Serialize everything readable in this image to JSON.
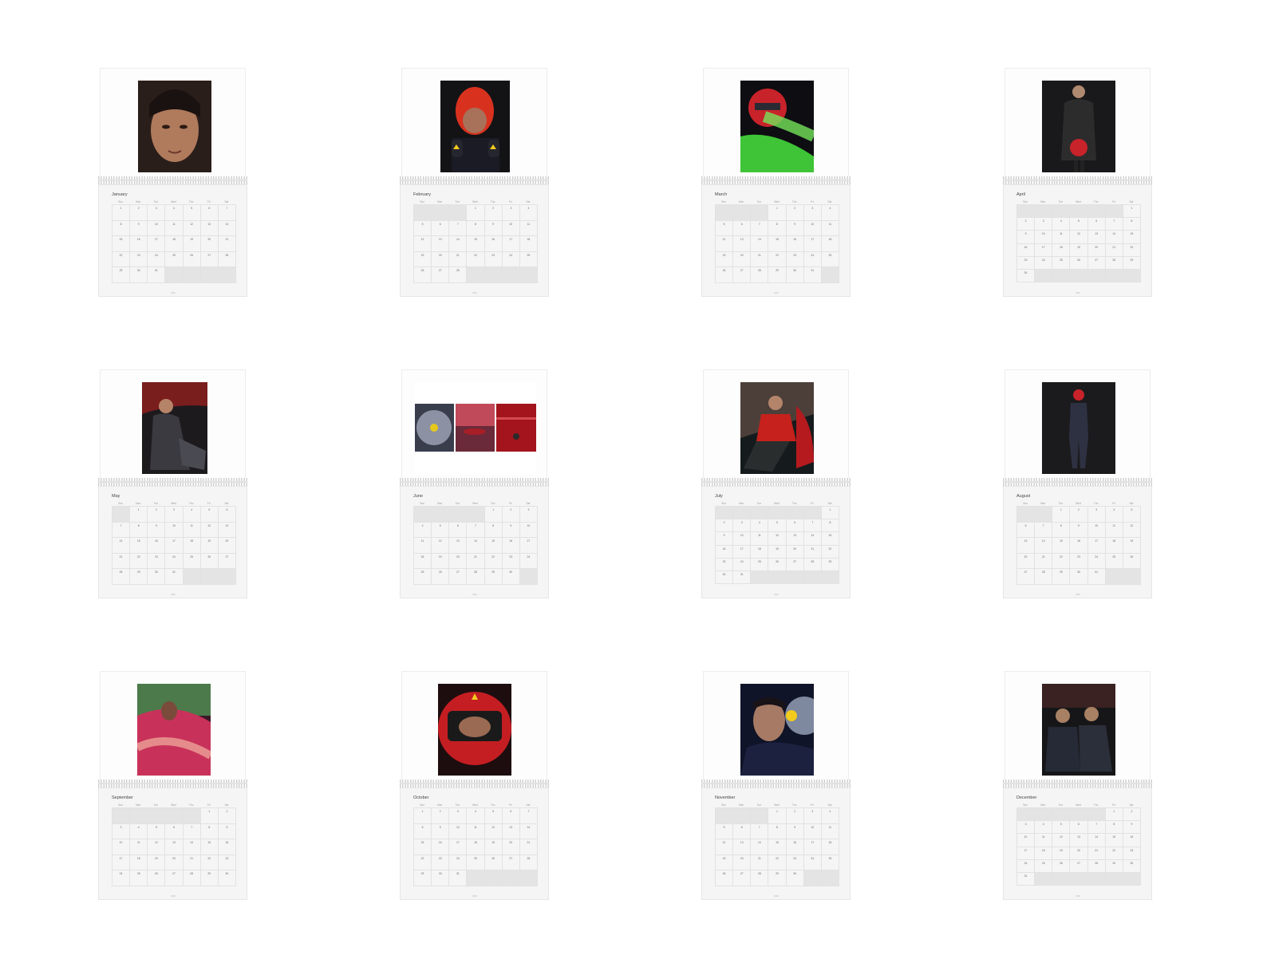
{
  "weekdays": [
    "Sun",
    "Mon",
    "Tue",
    "Wed",
    "Thu",
    "Fri",
    "Sat"
  ],
  "months": [
    {
      "name": "January",
      "start": 0,
      "days": 31,
      "photo": "portrait-dark-hair"
    },
    {
      "name": "February",
      "start": 3,
      "days": 28,
      "photo": "red-balaclava-racer"
    },
    {
      "name": "March",
      "start": 3,
      "days": 31,
      "photo": "helmet-motion-blur"
    },
    {
      "name": "April",
      "start": 6,
      "days": 30,
      "photo": "leather-jacket-helmet"
    },
    {
      "name": "May",
      "start": 1,
      "days": 31,
      "photo": "car-seat-portrait"
    },
    {
      "name": "June",
      "start": 4,
      "days": 30,
      "photo": "ferrari-triptych"
    },
    {
      "name": "July",
      "start": 6,
      "days": 31,
      "photo": "red-sweater-car"
    },
    {
      "name": "August",
      "start": 2,
      "days": 31,
      "photo": "full-body-helmet"
    },
    {
      "name": "September",
      "start": 5,
      "days": 30,
      "photo": "blurred-car-window"
    },
    {
      "name": "October",
      "start": 0,
      "days": 31,
      "photo": "red-helmet-closeup"
    },
    {
      "name": "November",
      "start": 3,
      "days": 30,
      "photo": "blue-light-portrait"
    },
    {
      "name": "December",
      "start": 5,
      "days": 31,
      "photo": "two-men-dark"
    }
  ]
}
